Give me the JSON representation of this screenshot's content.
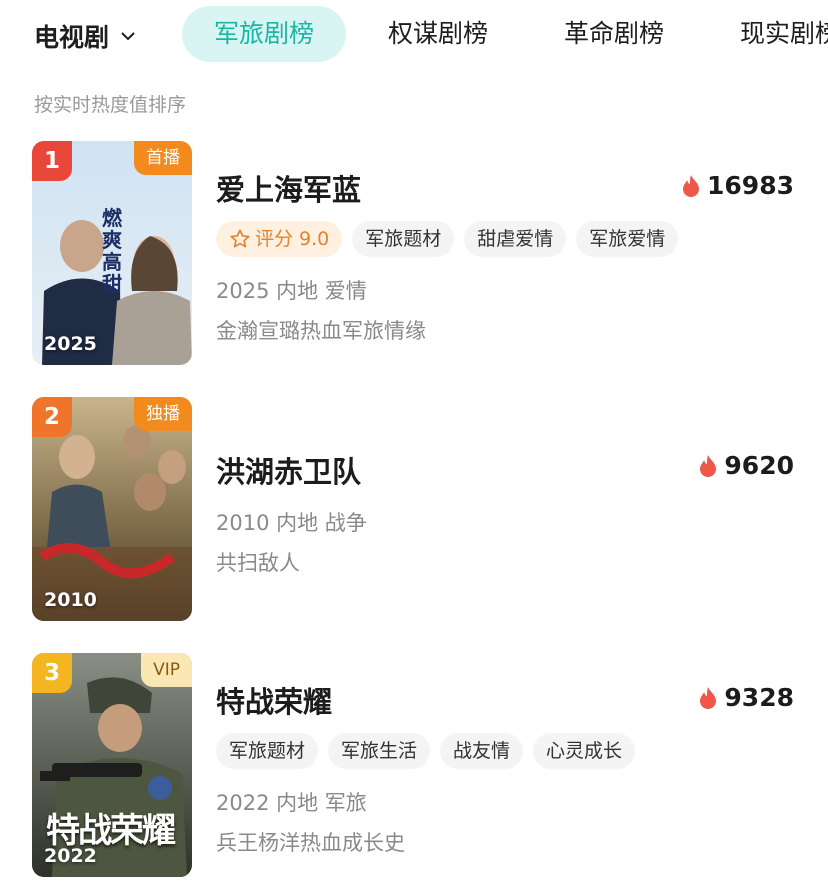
{
  "header": {
    "category": "电视剧",
    "tabs": [
      {
        "label": "军旅剧榜",
        "active": true
      },
      {
        "label": "权谋剧榜",
        "active": false
      },
      {
        "label": "革命剧榜",
        "active": false
      },
      {
        "label": "现实剧榜",
        "active": false
      }
    ]
  },
  "sort_hint": "按实时热度值排序",
  "accent_color": "#19b6a7",
  "items": [
    {
      "rank": "1",
      "rank_color": "#e8473a",
      "badge": "首播",
      "badge_color": "#f28a1e",
      "poster_year": "2025",
      "poster_text": "燃爽高甜",
      "title": "爱上海军蓝",
      "heat": "16983",
      "score_label": "评分 9.0",
      "tags": [
        "军旅题材",
        "甜虐爱情",
        "军旅爱情"
      ],
      "meta": "2025 内地 爱情",
      "desc": "金瀚宣璐热血军旅情缘"
    },
    {
      "rank": "2",
      "rank_color": "#f0752a",
      "badge": "独播",
      "badge_color": "#f28a1e",
      "poster_year": "2010",
      "title": "洪湖赤卫队",
      "heat": "9620",
      "meta": "2010 内地 战争",
      "desc": "共扫敌人"
    },
    {
      "rank": "3",
      "rank_color": "#f4b520",
      "badge": "VIP",
      "poster_year": "2022",
      "poster_text": "特战荣耀",
      "title": "特战荣耀",
      "heat": "9328",
      "tags": [
        "军旅题材",
        "军旅生活",
        "战友情",
        "心灵成长"
      ],
      "meta": "2022 内地 军旅",
      "desc": "兵王杨洋热血成长史"
    }
  ]
}
